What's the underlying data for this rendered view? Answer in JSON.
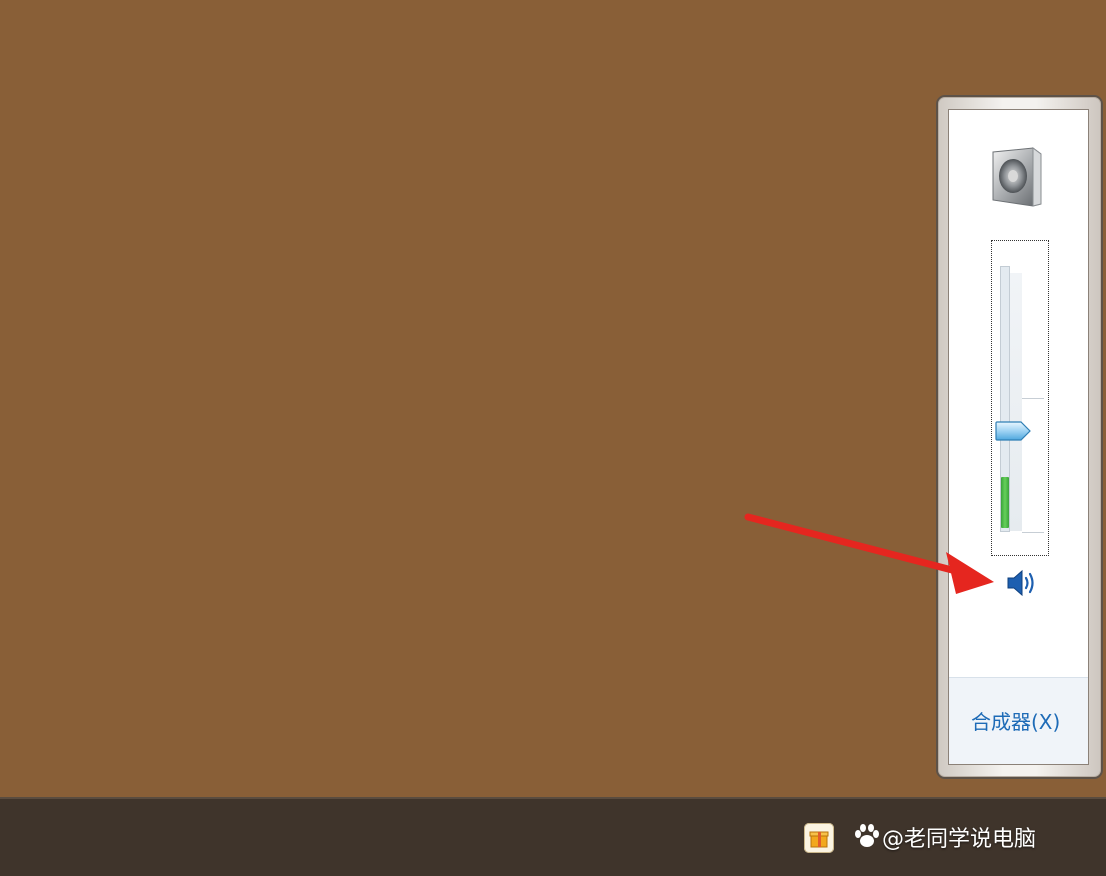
{
  "volume_flyout": {
    "device_icon": "speaker-device-icon",
    "volume_level": 0.38,
    "peak_meter_level": 0.19,
    "mute_icon": "speaker-volume-icon",
    "mixer_link_label": "合成器(X)"
  },
  "taskbar": {
    "tray_icon": "gift-box-icon",
    "watermark_logo": "paw-icon",
    "watermark_text": "@老同学说电脑"
  },
  "annotation": {
    "arrow_color": "#e5261f"
  }
}
